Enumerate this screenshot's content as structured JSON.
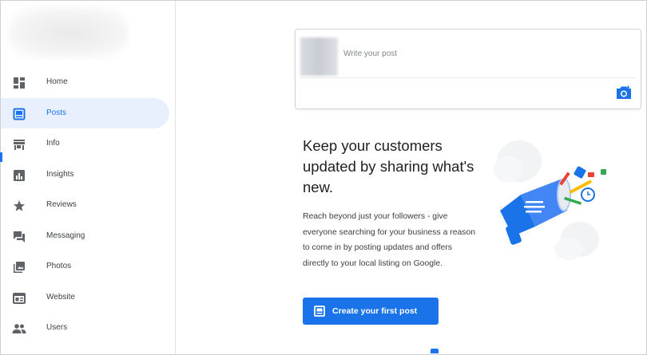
{
  "sidebar": {
    "items": [
      {
        "label": "Home",
        "icon": "dashboard-icon",
        "active": false
      },
      {
        "label": "Posts",
        "icon": "posts-icon",
        "active": true
      },
      {
        "label": "Info",
        "icon": "storefront-icon",
        "active": false
      },
      {
        "label": "Insights",
        "icon": "insights-icon",
        "active": false
      },
      {
        "label": "Reviews",
        "icon": "star-icon",
        "active": false
      },
      {
        "label": "Messaging",
        "icon": "chat-icon",
        "active": false
      },
      {
        "label": "Photos",
        "icon": "photos-icon",
        "active": false
      },
      {
        "label": "Website",
        "icon": "website-icon",
        "active": false
      },
      {
        "label": "Users",
        "icon": "users-icon",
        "active": false
      }
    ]
  },
  "composer": {
    "placeholder": "Write your post",
    "camera_icon": "camera-icon"
  },
  "main": {
    "headline": "Keep your customers updated by sharing what's new.",
    "body": "Reach beyond just your followers - give everyone searching for your business a reason to come in by posting updates and offers directly to your local listing on Google.",
    "cta_label": "Create your first post",
    "cta_icon": "create-post-icon"
  },
  "colors": {
    "accent": "#1a73e8",
    "active_bg": "#e8f0fe",
    "text": "#202124",
    "muted": "#80868b"
  }
}
